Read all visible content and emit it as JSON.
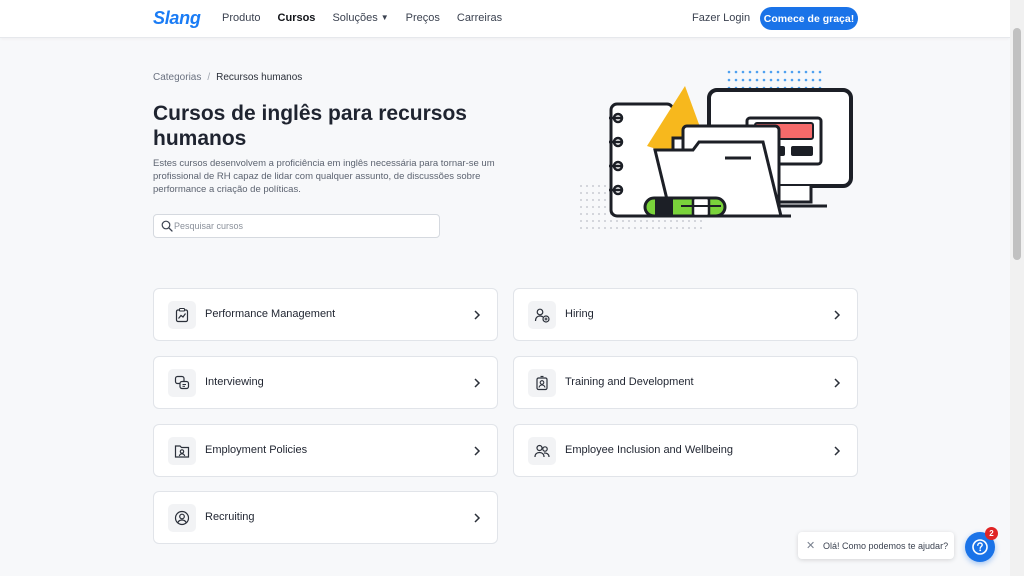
{
  "header": {
    "logo": "Slang",
    "nav": [
      "Produto",
      "Cursos",
      "Soluções",
      "Preços",
      "Carreiras"
    ],
    "login": "Fazer Login",
    "cta": "Comece de graça!"
  },
  "breadcrumb": {
    "parent": "Categorias",
    "separator": "/",
    "current": "Recursos humanos"
  },
  "hero": {
    "title": "Cursos de inglês para recursos humanos",
    "description": "Estes cursos desenvolvem a proficiência em inglês necessária para tornar-se um profissional de RH capaz de lidar com qualquer assunto, de discussões sobre performance a criação de políticas.",
    "search_placeholder": "Pesquisar cursos"
  },
  "categories": [
    {
      "label": "Performance Management",
      "icon": "clipboard-chart-icon"
    },
    {
      "label": "Hiring",
      "icon": "user-add-icon"
    },
    {
      "label": "Interviewing",
      "icon": "chat-bubbles-icon"
    },
    {
      "label": "Training and Development",
      "icon": "badge-person-icon"
    },
    {
      "label": "Employment Policies",
      "icon": "folder-person-icon"
    },
    {
      "label": "Employee Inclusion and Wellbeing",
      "icon": "group-icon"
    },
    {
      "label": "Recruiting",
      "icon": "user-circle-icon"
    }
  ],
  "chat": {
    "message": "Olá! Como podemos te ajudar?",
    "badge": "2"
  },
  "colors": {
    "brand": "#1a73e8",
    "illustration_yellow": "#f7b81d",
    "illustration_green": "#7ad33b",
    "illustration_red": "#f56a6a",
    "badge_red": "#e02424"
  }
}
